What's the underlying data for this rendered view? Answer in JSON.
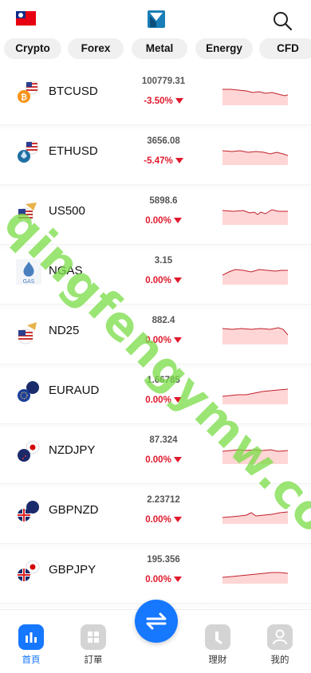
{
  "categories": [
    "Crypto",
    "Forex",
    "Metal",
    "Energy",
    "CFD"
  ],
  "rows": [
    {
      "symbol": "BTCUSD",
      "price": "100779.31",
      "change": "-3.50%",
      "icon": "btc-usd-icon"
    },
    {
      "symbol": "ETHUSD",
      "price": "3656.08",
      "change": "-5.47%",
      "icon": "eth-usd-icon"
    },
    {
      "symbol": "US500",
      "price": "5898.6",
      "change": "0.00%",
      "icon": "us500-icon"
    },
    {
      "symbol": "NGAS",
      "price": "3.15",
      "change": "0.00%",
      "icon": "gas-icon"
    },
    {
      "symbol": "ND25",
      "price": "882.4",
      "change": "0.00%",
      "icon": "nd25-icon"
    },
    {
      "symbol": "EURAUD",
      "price": "1.66785",
      "change": "0.00%",
      "icon": "eur-aud-icon"
    },
    {
      "symbol": "NZDJPY",
      "price": "87.324",
      "change": "0.00%",
      "icon": "nzd-jpy-icon"
    },
    {
      "symbol": "GBPNZD",
      "price": "2.23712",
      "change": "0.00%",
      "icon": "gbp-nzd-icon"
    },
    {
      "symbol": "GBPJPY",
      "price": "195.356",
      "change": "0.00%",
      "icon": "gbp-jpy-icon"
    }
  ],
  "watermark": "qingfengymw.com",
  "tabs": [
    "首頁",
    "訂單",
    "理財",
    "我的"
  ],
  "colors": {
    "accent": "#1677ff",
    "down": "#e0192c",
    "sparkline_fill": "#ffd6d6"
  }
}
